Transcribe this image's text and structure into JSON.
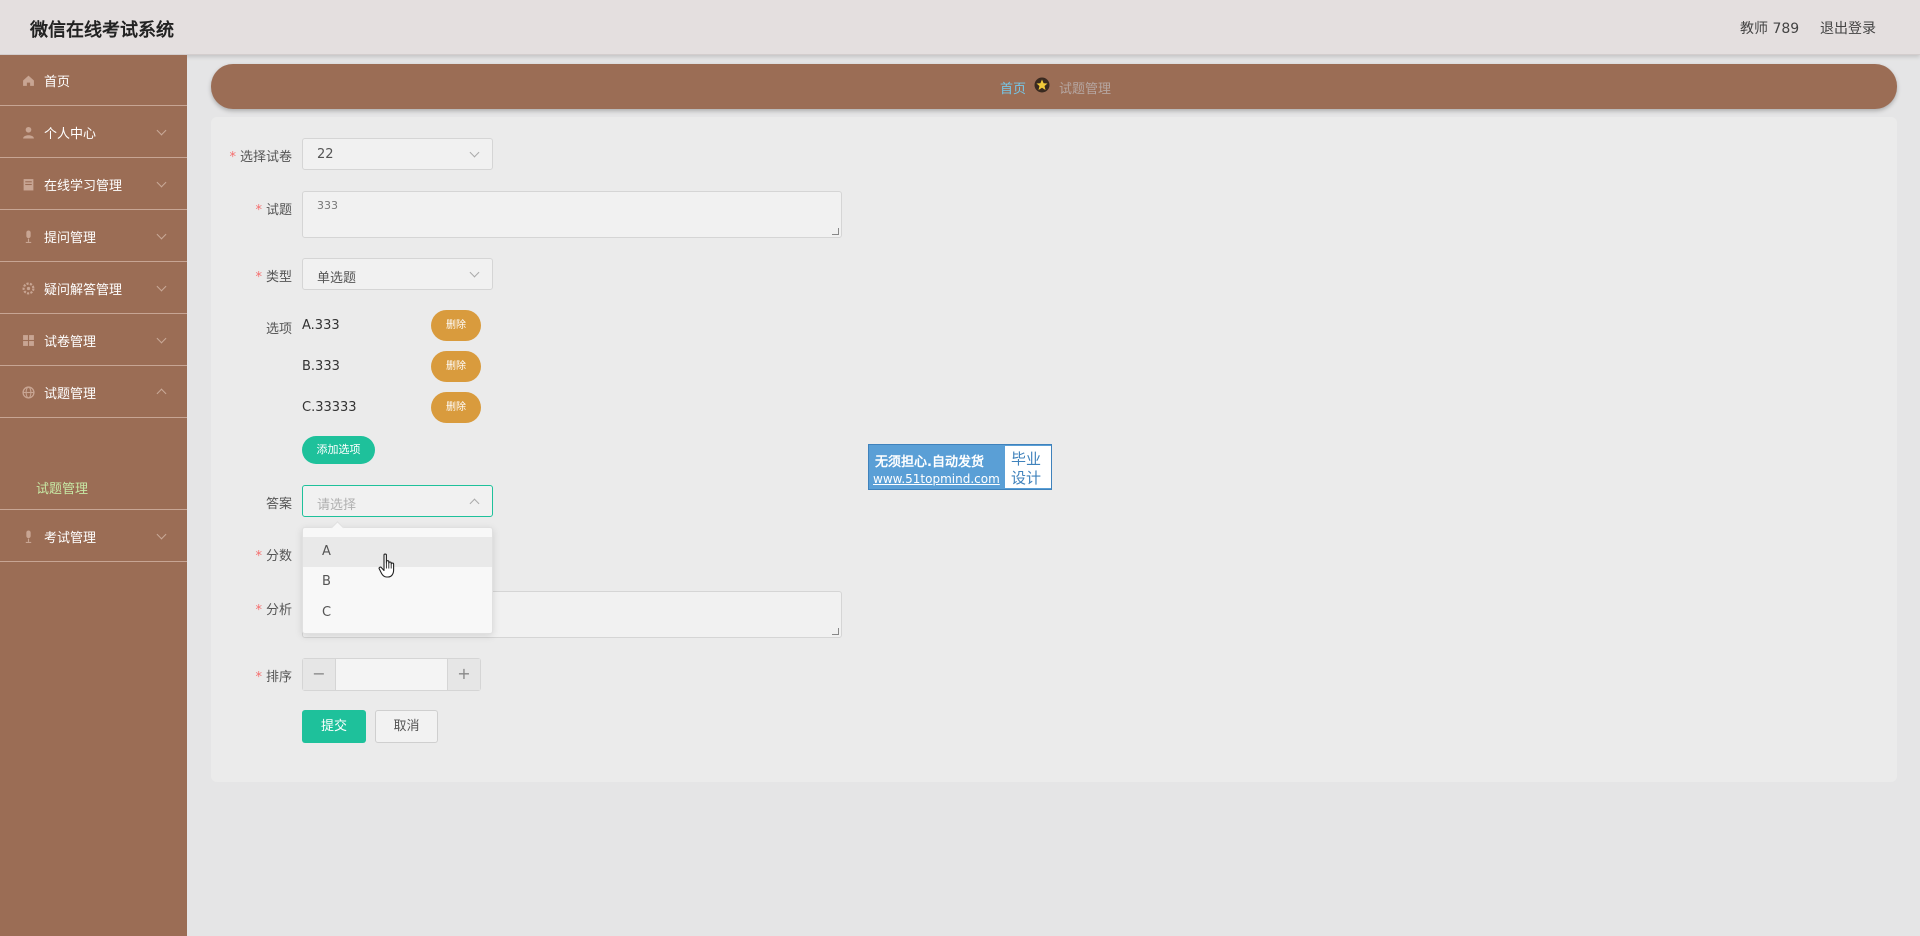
{
  "header": {
    "app_title": "微信在线考试系统",
    "user": "教师 789",
    "logout": "退出登录"
  },
  "sidebar": {
    "items": [
      {
        "label": "首页",
        "icon": "home-icon"
      },
      {
        "label": "个人中心",
        "icon": "user-icon"
      },
      {
        "label": "在线学习管理",
        "icon": "book-icon"
      },
      {
        "label": "提问管理",
        "icon": "microphone-icon"
      },
      {
        "label": "疑问解答管理",
        "icon": "settings-icon"
      },
      {
        "label": "试卷管理",
        "icon": "grid-icon"
      },
      {
        "label": "试题管理",
        "icon": "globe-icon"
      },
      {
        "label": "考试管理",
        "icon": "microphone-icon"
      }
    ],
    "submenu": {
      "label": "试题管理"
    }
  },
  "breadcrumb": {
    "home": "首页",
    "current": "试题管理"
  },
  "form": {
    "paper": {
      "label": "选择试卷",
      "value": "22"
    },
    "question": {
      "label": "试题",
      "value": "333"
    },
    "type": {
      "label": "类型",
      "value": "单选题"
    },
    "options": {
      "label": "选项",
      "items": [
        "A.333",
        "B.333",
        "C.33333"
      ],
      "delete_label": "删除",
      "add_label": "添加选项"
    },
    "answer": {
      "label": "答案",
      "placeholder": "请选择",
      "dropdown": [
        "A",
        "B",
        "C"
      ]
    },
    "score": {
      "label": "分数"
    },
    "analysis": {
      "label": "分析"
    },
    "sort": {
      "label": "排序",
      "minus": "−",
      "plus": "+"
    },
    "submit": "提交",
    "cancel": "取消"
  },
  "watermark": {
    "line1": "无须担心.自动发货",
    "line2": "www.51topmind.com",
    "box1": "毕业",
    "box2": "设计"
  },
  "colors": {
    "sidebar": "#9b6d55",
    "accent_green": "#1ec19b",
    "delete_orange": "#d99b3d",
    "breadcrumb_link": "#76c7e8"
  }
}
